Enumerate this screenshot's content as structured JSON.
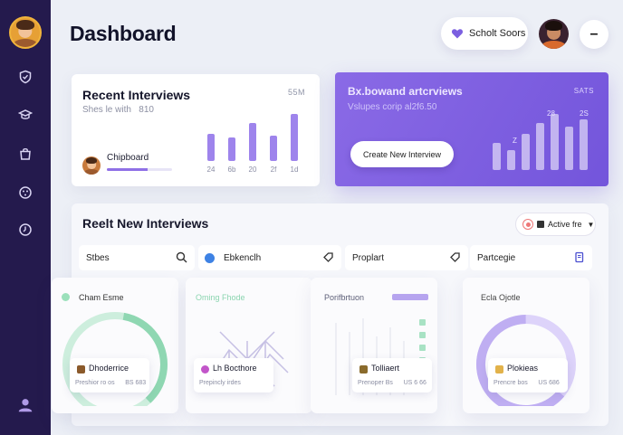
{
  "header": {
    "title": "Dashboard",
    "pill_label": "Scholt Soors",
    "circle_label": "–"
  },
  "recent": {
    "title": "Recent Interviews",
    "subtitle": "Shes le with   810",
    "count": "55M",
    "chip_label": "Chipboard",
    "chip_progress": 0.62,
    "bars": [
      {
        "label": "24",
        "value": 30
      },
      {
        "label": "6b",
        "value": 26
      },
      {
        "label": "20",
        "value": 42
      },
      {
        "label": "2f",
        "value": 28
      },
      {
        "label": "1d",
        "value": 52
      }
    ]
  },
  "promo": {
    "title": "Bx.bowand artcrviews",
    "subtitle": "Vslupes corip al2f6.50",
    "count": "SATS",
    "button": "Create New Interview",
    "bar_labels": [
      "28",
      "2S",
      "Z"
    ]
  },
  "panel": {
    "title": "Reelt New Interviews",
    "status": "Active fre",
    "filters": [
      "Stbes",
      "Ebkenclh",
      "Proplart",
      "Partcegie"
    ],
    "tiles": [
      {
        "title": "Cham Esme",
        "card_name": "Dhoderrice",
        "card_sub": "Preshior ro os      BS 683",
        "color": "#9ee0c2"
      },
      {
        "title": "Oming Fhode",
        "card_name": "Lh Bocthore",
        "card_sub": "Prepincly irdes",
        "color": "#b8b2dc"
      },
      {
        "title": "Porifbrtuon",
        "card_name": "Tolliaert",
        "card_sub": "Prenoper Bs      US 6 66",
        "color": "#cfd2dc"
      },
      {
        "title": "Ecla Ojotle",
        "card_name": "Plokieas",
        "card_sub": "Prencre bos      US 686",
        "color": "#c4b5f2"
      }
    ]
  }
}
